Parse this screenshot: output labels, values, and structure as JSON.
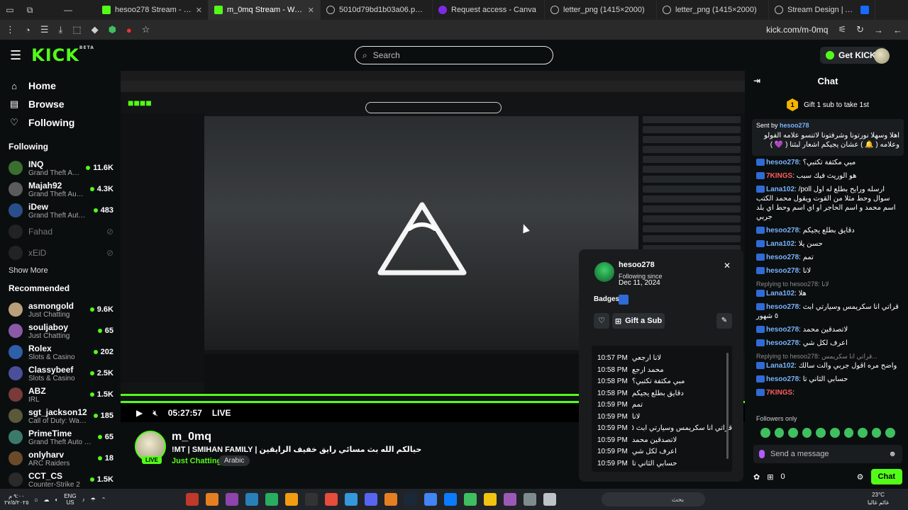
{
  "browser": {
    "tabs": [
      {
        "label": "hesoo278 Stream - Watch Live on Kick",
        "icon": "kick-icon",
        "active": false
      },
      {
        "label": "m_0mq Stream - Watch Live on Kick",
        "icon": "kick-icon",
        "active": true
      },
      {
        "label": "5010d79bd1b03a06.png (764×...)",
        "icon": "globe-icon",
        "active": false
      },
      {
        "label": "Request access - Canva",
        "icon": "canva-icon",
        "active": false
      },
      {
        "label": "letter_png (1415×2000)",
        "icon": "globe-icon",
        "active": false
      },
      {
        "label": "letter_png (1415×2000)",
        "icon": "globe-icon",
        "active": false
      },
      {
        "label": "Stream Design | Abo 3h : Behance",
        "icon": "behance-icon",
        "active": false
      }
    ],
    "url": "kick.com/m-0mq"
  },
  "header": {
    "logo": "KICK",
    "logo_beta": "BETA",
    "search_placeholder": "Search",
    "get_kicks_label": "Get KICKs"
  },
  "sidebar": {
    "nav": [
      {
        "label": "Home",
        "icon": "home-icon"
      },
      {
        "label": "Browse",
        "icon": "browse-icon"
      },
      {
        "label": "Following",
        "icon": "heart-icon"
      }
    ],
    "following_title": "Following",
    "following": [
      {
        "name": "INQ",
        "game": "Grand Theft Auto V (...",
        "viewers": "11.6K",
        "color": "#3a6f2f"
      },
      {
        "name": "Majah92",
        "game": "Grand Theft Auto V (...",
        "viewers": "4.3K",
        "color": "#5b5b5b"
      },
      {
        "name": "iDew",
        "game": "Grand Theft Auto V (G...",
        "viewers": "483",
        "color": "#2a4e8a"
      },
      {
        "name": "Fahad",
        "game": "",
        "viewers": "",
        "color": "#444"
      },
      {
        "name": "xEiD",
        "game": "",
        "viewers": "",
        "color": "#444"
      }
    ],
    "show_more": "Show More",
    "recommended_title": "Recommended",
    "recommended": [
      {
        "name": "asmongold",
        "game": "Just Chatting",
        "viewers": "9.6K",
        "color": "#b9a07a"
      },
      {
        "name": "souljaboy",
        "game": "Just Chatting",
        "viewers": "65",
        "color": "#8a5aa8"
      },
      {
        "name": "Rolex",
        "game": "Slots & Casino",
        "viewers": "202",
        "color": "#2e5fa8"
      },
      {
        "name": "Classybeef",
        "game": "Slots & Casino",
        "viewers": "2.5K",
        "color": "#4b4f9a"
      },
      {
        "name": "ABZ",
        "game": "IRL",
        "viewers": "1.5K",
        "color": "#7a3a3a"
      },
      {
        "name": "sgt_jackson12",
        "game": "Call of Duty: Warzone",
        "viewers": "185",
        "color": "#5a5a3a"
      },
      {
        "name": "PrimeTime",
        "game": "Grand Theft Auto V (GTA)",
        "viewers": "65",
        "color": "#3a7a6a"
      },
      {
        "name": "onlyharv",
        "game": "ARC Raiders",
        "viewers": "18",
        "color": "#6a4a2a"
      },
      {
        "name": "CCT_CS",
        "game": "Counter-Strike 2",
        "viewers": "1.5K",
        "color": "#2a2a2a"
      }
    ]
  },
  "player": {
    "time": "05:27:57",
    "live_label": "LIVE"
  },
  "stream": {
    "channel": "m_0mq",
    "live_badge": "LIVE",
    "title": "!MT | SMIHAN FAMILY | حيالكم الله بث مسائي رايق خفيف الرايقين",
    "category": "Just Chatting",
    "language": "Arabic"
  },
  "user_card": {
    "username": "hesoo278",
    "following_since_label": "Following since",
    "following_since": "Dec 11, 2024",
    "badges_label": "Badges",
    "gift_label": "Gift a Sub",
    "history": [
      {
        "time": "10:57 PM",
        "text": "لانا ارجعي"
      },
      {
        "time": "10:58 PM",
        "text": "محمد ارجع"
      },
      {
        "time": "10:58 PM",
        "text": "مبي مكثفة تكتبي؟"
      },
      {
        "time": "10:58 PM",
        "text": "دقايق بطلع يجيكم"
      },
      {
        "time": "10:59 PM",
        "text": "تمم"
      },
      {
        "time": "10:59 PM",
        "text": "لانا"
      },
      {
        "time": "10:59 PM",
        "text": "قراتي انا سكريمس وسيارتي ابث ٥ شهور"
      },
      {
        "time": "10:59 PM",
        "text": "لاتصدقين محمد"
      },
      {
        "time": "10:59 PM",
        "text": "اعرف لكل شي"
      },
      {
        "time": "10:59 PM",
        "text": "حسابي الثاني تا"
      }
    ]
  },
  "chat": {
    "title": "Chat",
    "gift_banner": "Gift 1 sub to take 1st",
    "pinned_sent_by": "Sent by",
    "pinned_user": "hesoo278",
    "pinned_message": "اهلا وسهلا نورتونا وشرفتونا لاتنسو علامه الفولو وعلامه ( 🔔 ) عشان يجيكم اشعار لبثنا ( 💜 )",
    "messages": [
      {
        "user": "hesoo278",
        "text": "مبي مكثفة تكتبي؟",
        "reply": "",
        "red": false
      },
      {
        "user": "7KINGS",
        "text": "هو الوريث فيك سبب",
        "reply": "",
        "red": true
      },
      {
        "user": "Lana102",
        "text": "/poll ارسله ورايح بطلع له اول سوال وحط مثلا من القوت ويقول محمد الكتب اسم محمد و اسم الحاجر او اي اسم وحط اي بلد جربي",
        "reply": "",
        "red": false
      },
      {
        "user": "hesoo278",
        "text": "دقايق بطلع يجيكم",
        "reply": "",
        "red": false
      },
      {
        "user": "Lana102",
        "text": "حسن يلا",
        "reply": "",
        "red": false
      },
      {
        "user": "hesoo278",
        "text": "تمم",
        "reply": "",
        "red": false
      },
      {
        "user": "hesoo278",
        "text": "لانا",
        "reply": "",
        "red": false
      },
      {
        "user": "Lana102",
        "text": "هلا",
        "reply": "Replying to hesoo278: لانا",
        "red": false
      },
      {
        "user": "hesoo278",
        "text": "قراتي انا سكريمس وسيارتي ابث ٥ شهور",
        "reply": "",
        "red": false
      },
      {
        "user": "hesoo278",
        "text": "لاتصدقين محمد",
        "reply": "",
        "red": false
      },
      {
        "user": "hesoo278",
        "text": "اعرف لكل شي",
        "reply": "",
        "red": false
      },
      {
        "user": "Lana102",
        "text": "واضح مره اقول جربي والت سالك",
        "reply": "Replying to hesoo278: قراتي انا سكريمس...",
        "red": false
      },
      {
        "user": "hesoo278",
        "text": "حسابي الثاني تا",
        "reply": "",
        "red": false
      },
      {
        "user": "7KINGS",
        "text": "",
        "reply": "",
        "red": true
      }
    ],
    "followers_only": "Followers only",
    "input_placeholder": "Send a message",
    "points": "0",
    "send_label": "Chat"
  },
  "taskbar": {
    "time": "٩:٠٠ م",
    "date": "٢٧/٥/٢٠٢٥",
    "lang": "ENG",
    "lang2": "US",
    "search": "بحث",
    "weather": "23°C",
    "weather_desc": "غائم غالبا"
  }
}
